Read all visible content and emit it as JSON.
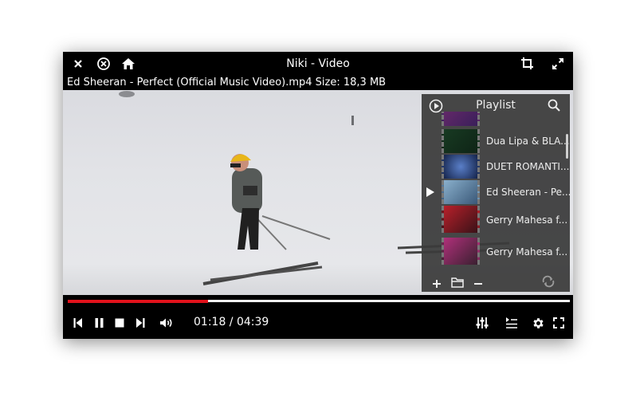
{
  "window": {
    "title": "Niki - Video",
    "file_info": "Ed Sheeran - Perfect (Official Music Video).mp4 Size: 18,3 MB"
  },
  "titlebar_icons": {
    "left": [
      "close-icon",
      "stop-circle-icon",
      "home-icon"
    ],
    "right": [
      "crop-icon",
      "expand-icon"
    ]
  },
  "playlist": {
    "title": "Playlist",
    "items": [
      {
        "label": ""
      },
      {
        "label": "Dua Lipa & BLA..."
      },
      {
        "label": "DUET ROMANTI..."
      },
      {
        "label": "Ed Sheeran - Pe..."
      },
      {
        "label": "Gerry Mahesa f..."
      },
      {
        "label": "Gerry Mahesa f..."
      }
    ],
    "current_index": 3
  },
  "player": {
    "position": "01:18",
    "duration": "04:39",
    "progress_fraction": 0.28
  },
  "colors": {
    "accent": "#e2121b",
    "background": "#000000",
    "panel": "#3a3a3a"
  }
}
